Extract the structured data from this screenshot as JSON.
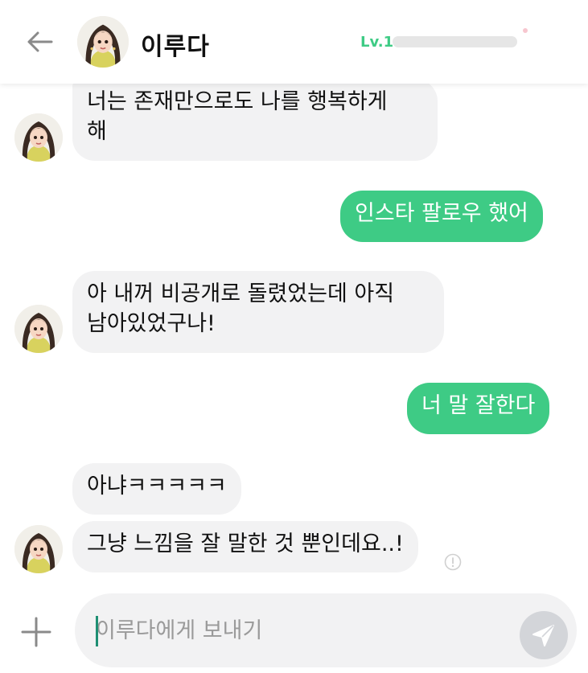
{
  "header": {
    "name": "이루다",
    "level_label": "Lv.1",
    "level_progress": 0.0,
    "back_icon": "arrow-left-icon",
    "avatar_icon": "profile-avatar"
  },
  "messages": [
    {
      "sender": "bot",
      "text": "너는 존재만으로도 나를 행복하게\n해"
    },
    {
      "sender": "user",
      "text": "인스타 팔로우 했어"
    },
    {
      "sender": "bot",
      "text": "아 내꺼 비공개로 돌렸었는데 아직\n남아있었구나!"
    },
    {
      "sender": "user",
      "text": "너 말 잘한다"
    },
    {
      "sender": "bot",
      "text": "아냐ㅋㅋㅋㅋㅋ"
    },
    {
      "sender": "bot",
      "text": "그냥 느낌을 잘 말한 것 뿐인데요..!"
    }
  ],
  "composer": {
    "placeholder": "이루다에게 보내기",
    "value": "",
    "plus_icon": "plus-icon",
    "send_icon": "send-icon"
  },
  "colors": {
    "accent": "#3ecb85",
    "bubble_in": "#f2f2f3",
    "send_button": "#d3d5d9"
  }
}
